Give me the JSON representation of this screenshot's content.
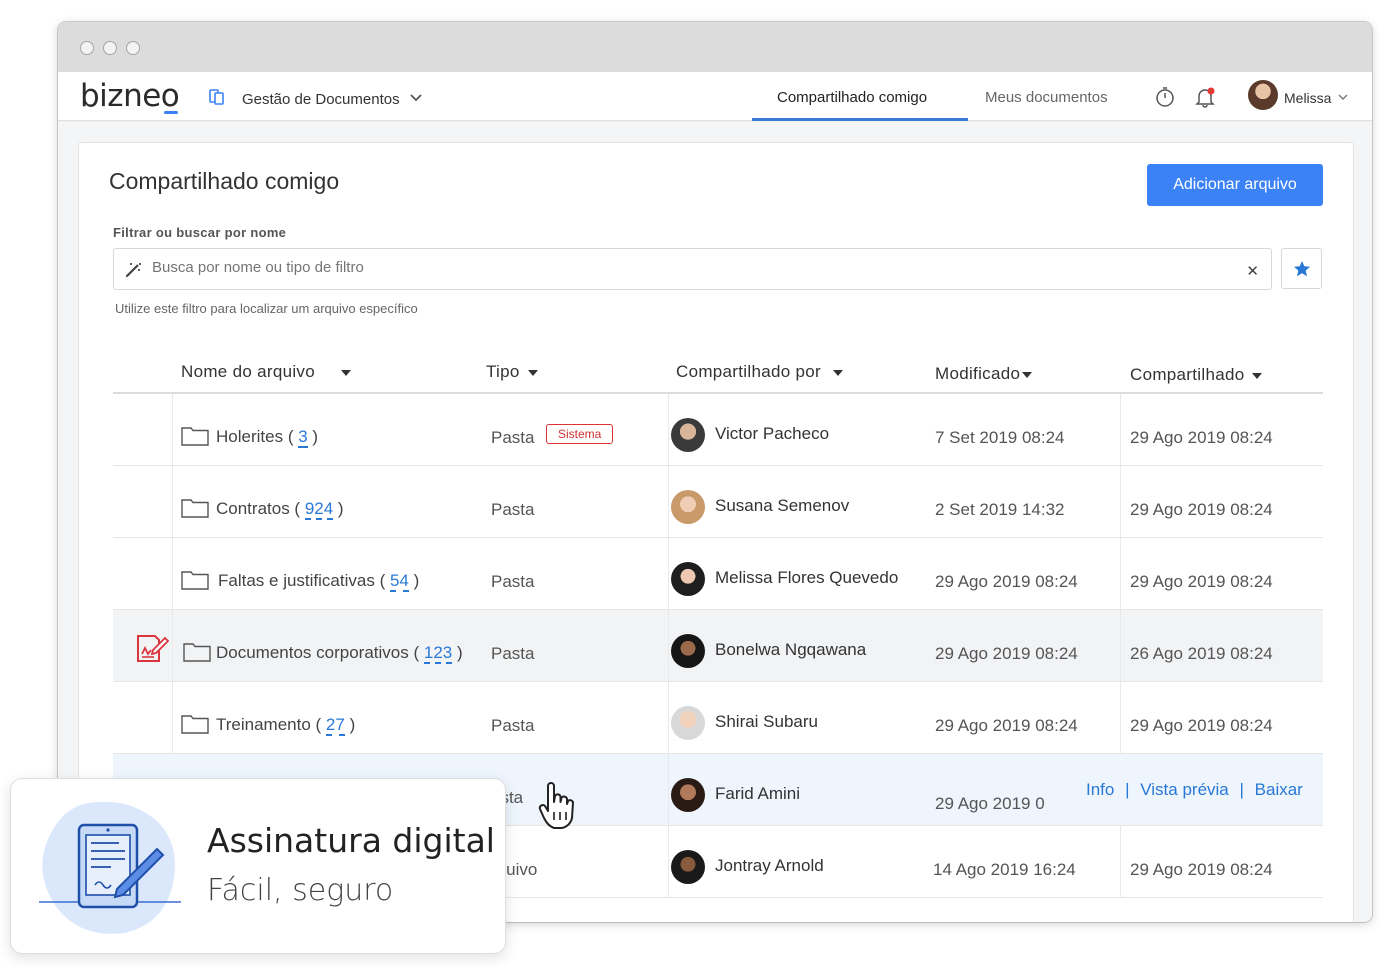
{
  "app": {
    "logo": "bizneo",
    "module": "Gestão de Documentos",
    "tabs": [
      "Compartilhado comigo",
      "Meus documentos"
    ],
    "active_tab": "Compartilhado comigo",
    "user": "Melissa"
  },
  "page": {
    "title": "Compartilhado comigo",
    "add_button": "Adicionar arquivo",
    "filter_label": "Filtrar ou buscar por nome",
    "search_placeholder": "Busca por nome ou tipo de filtro",
    "filter_help": "Utilize este filtro para localizar um arquivo específico"
  },
  "columns": [
    "Nome do arquivo",
    "Tipo",
    "Compartilhado por",
    "Modificado",
    "Compartilhado"
  ],
  "rows": [
    {
      "name": "Holerites",
      "count": "3",
      "type": "Pasta",
      "badge": "Sistema",
      "sharer": "Victor Pacheco",
      "modified": "7 Set 2019 08:24",
      "shared": "29 Ago 2019 08:24"
    },
    {
      "name": "Contratos",
      "count": "924",
      "type": "Pasta",
      "sharer": "Susana Semenov",
      "modified": "2 Set 2019 14:32",
      "shared": "29 Ago 2019 08:24"
    },
    {
      "name": "Faltas e justificativas",
      "count": "54",
      "type": "Pasta",
      "sharer": "Melissa Flores Quevedo",
      "modified": "29 Ago 2019 08:24",
      "shared": "29 Ago 2019 08:24"
    },
    {
      "name": "Documentos corporativos",
      "count": "123",
      "type": "Pasta",
      "sharer": "Bonelwa Ngqawana",
      "modified": "29 Ago 2019 08:24",
      "shared": "26 Ago 2019 08:24"
    },
    {
      "name": "Treinamento",
      "count": "27",
      "type": "Pasta",
      "sharer": "Shirai Subaru",
      "modified": "29 Ago 2019 08:24",
      "shared": "29 Ago 2019 08:24"
    },
    {
      "type": "asta",
      "sharer": "Farid Amini",
      "modified": "29 Ago 2019 0"
    },
    {
      "type": "rquivo",
      "sharer": "Jontray Arnold",
      "modified": "14 Ago 2019 16:24",
      "shared": "29 Ago 2019 08:24"
    }
  ],
  "row_actions": {
    "info": "Info",
    "preview": "Vista prévia",
    "download": "Baixar",
    "separator": "|"
  },
  "promo": {
    "title": "Assinatura digital",
    "subtitle": "Fácil, seguro"
  },
  "colors": {
    "accent": "#3b82f6",
    "link": "#2a78d6",
    "badge": "#cc3333",
    "sign_icon": "#d9363e"
  }
}
